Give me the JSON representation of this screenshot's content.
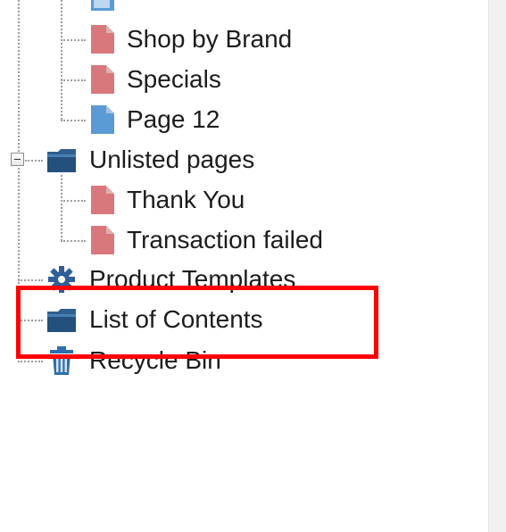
{
  "tree": {
    "items": [
      {
        "label": "",
        "icon": "page-icon"
      },
      {
        "label": "Shop by Brand",
        "icon": "page-red-icon"
      },
      {
        "label": "Specials",
        "icon": "page-red-icon"
      },
      {
        "label": "Page 12",
        "icon": "page-blue-icon"
      },
      {
        "label": "Unlisted pages",
        "icon": "folder-icon"
      },
      {
        "label": "Thank You",
        "icon": "page-red-icon"
      },
      {
        "label": "Transaction failed",
        "icon": "page-red-icon"
      },
      {
        "label": "Product Templates",
        "icon": "gear-icon"
      },
      {
        "label": "List of Contents",
        "icon": "folder-icon"
      },
      {
        "label": "Recycle Bin",
        "icon": "trash-icon"
      }
    ]
  },
  "colors": {
    "highlight": "#ff0000",
    "page_red": "#d9787c",
    "page_blue": "#5b9bd5",
    "folder": "#2e5f8f",
    "gear": "#2f5f99"
  }
}
